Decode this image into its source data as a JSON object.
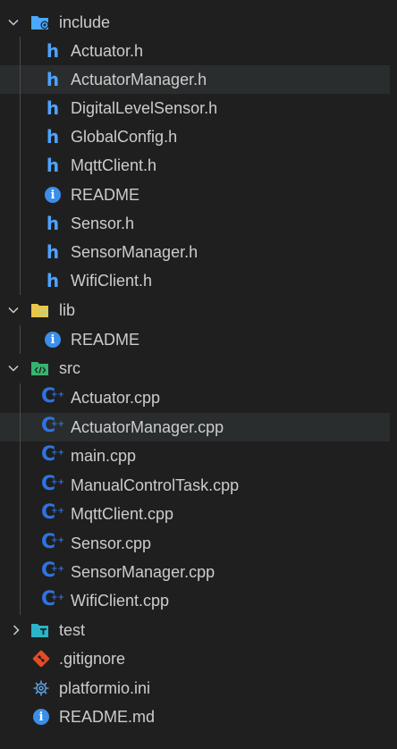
{
  "colors": {
    "background": "#1f1f1f",
    "selected_row": "#2a2d2e",
    "text": "#cccccc",
    "header_icon": "#4fa3ff",
    "info_icon": "#3b8eea",
    "cpp_icon": "#2f73e0",
    "folder_include": "#4aa8ff",
    "folder_lib": "#e8c64a",
    "folder_src": "#37b371",
    "folder_test": "#2ab4c8",
    "git_icon": "#e34c26",
    "gear_icon": "#5b9bd5"
  },
  "tree": {
    "include": {
      "label": "include",
      "expanded": true,
      "icon": "folder-include-icon",
      "files": [
        {
          "label": "Actuator.h",
          "icon": "h-file-icon"
        },
        {
          "label": "ActuatorManager.h",
          "icon": "h-file-icon",
          "selected": true
        },
        {
          "label": "DigitalLevelSensor.h",
          "icon": "h-file-icon"
        },
        {
          "label": "GlobalConfig.h",
          "icon": "h-file-icon"
        },
        {
          "label": "MqttClient.h",
          "icon": "h-file-icon"
        },
        {
          "label": "README",
          "icon": "info-icon"
        },
        {
          "label": "Sensor.h",
          "icon": "h-file-icon"
        },
        {
          "label": "SensorManager.h",
          "icon": "h-file-icon"
        },
        {
          "label": "WifiClient.h",
          "icon": "h-file-icon"
        }
      ]
    },
    "lib": {
      "label": "lib",
      "expanded": true,
      "icon": "folder-lib-icon",
      "files": [
        {
          "label": "README",
          "icon": "info-icon"
        }
      ]
    },
    "src": {
      "label": "src",
      "expanded": true,
      "icon": "folder-src-icon",
      "files": [
        {
          "label": "Actuator.cpp",
          "icon": "cpp-file-icon"
        },
        {
          "label": "ActuatorManager.cpp",
          "icon": "cpp-file-icon",
          "selected": true
        },
        {
          "label": "main.cpp",
          "icon": "cpp-file-icon"
        },
        {
          "label": "ManualControlTask.cpp",
          "icon": "cpp-file-icon"
        },
        {
          "label": "MqttClient.cpp",
          "icon": "cpp-file-icon"
        },
        {
          "label": "Sensor.cpp",
          "icon": "cpp-file-icon"
        },
        {
          "label": "SensorManager.cpp",
          "icon": "cpp-file-icon"
        },
        {
          "label": "WifiClient.cpp",
          "icon": "cpp-file-icon"
        }
      ]
    },
    "test": {
      "label": "test",
      "expanded": false,
      "icon": "folder-test-icon"
    },
    "root_files": [
      {
        "label": ".gitignore",
        "icon": "git-icon"
      },
      {
        "label": "platformio.ini",
        "icon": "gear-icon"
      },
      {
        "label": "README.md",
        "icon": "info-icon"
      }
    ]
  }
}
